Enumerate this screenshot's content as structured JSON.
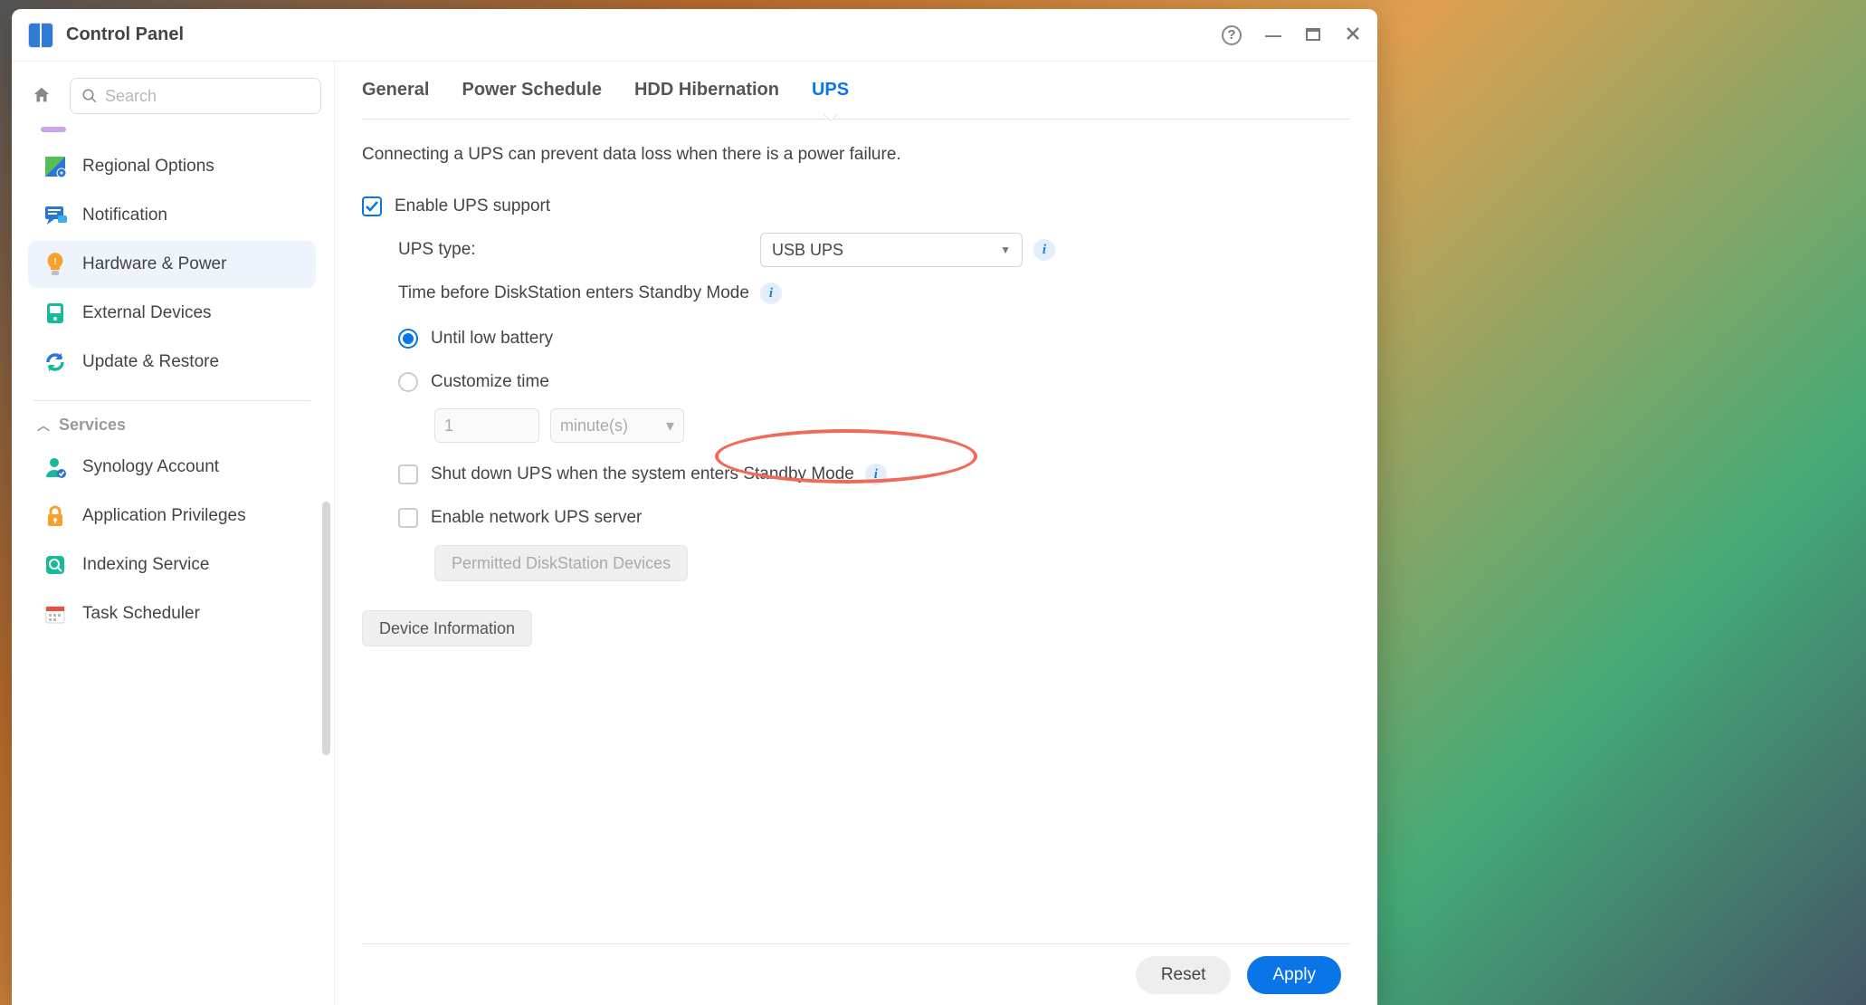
{
  "window": {
    "title": "Control Panel"
  },
  "search": {
    "placeholder": "Search"
  },
  "sidebar": {
    "items": [
      {
        "label": "Regional Options"
      },
      {
        "label": "Notification"
      },
      {
        "label": "Hardware & Power"
      },
      {
        "label": "External Devices"
      },
      {
        "label": "Update & Restore"
      }
    ],
    "group": {
      "title": "Services"
    },
    "services": [
      {
        "label": "Synology Account"
      },
      {
        "label": "Application Privileges"
      },
      {
        "label": "Indexing Service"
      },
      {
        "label": "Task Scheduler"
      }
    ]
  },
  "tabs": [
    {
      "label": "General"
    },
    {
      "label": "Power Schedule"
    },
    {
      "label": "HDD Hibernation"
    },
    {
      "label": "UPS"
    }
  ],
  "ups": {
    "intro": "Connecting a UPS can prevent data loss when there is a power failure.",
    "enable_label": "Enable UPS support",
    "type_label": "UPS type:",
    "type_value": "USB UPS",
    "standby_label": "Time before DiskStation enters Standby Mode",
    "radio_low_battery": "Until low battery",
    "radio_customize": "Customize time",
    "time_value": "1",
    "time_unit": "minute(s)",
    "shutdown_label": "Shut down UPS when the system enters Standby Mode",
    "net_server_label": "Enable network UPS server",
    "permitted_button": "Permitted DiskStation Devices",
    "device_info_button": "Device Information"
  },
  "footer": {
    "reset": "Reset",
    "apply": "Apply"
  }
}
